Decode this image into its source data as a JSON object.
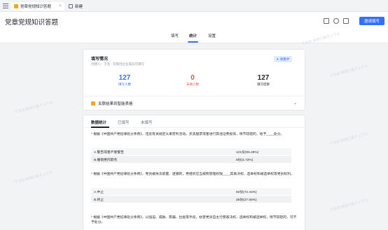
{
  "tabs": {
    "active_label": "党章党规知识答题",
    "close_glyph": "×",
    "new_label": "新建"
  },
  "header": {
    "title": "党章党规知识答题",
    "fill_button": "邀请填写",
    "nav": [
      "填写",
      "统计",
      "设置"
    ],
    "nav_active": "统计"
  },
  "summary": {
    "title": "填写情况",
    "meta": "创建人：于洛  ·  仅限创企业成员可填写",
    "status": "收集中",
    "stats": [
      {
        "value": "127",
        "label": "填写人数",
        "color": "#3370ff"
      },
      {
        "value": "0",
        "label": "未填人数",
        "color": "#f54a45"
      },
      {
        "value": "127",
        "label": "填写结果",
        "color": "#1f2329"
      }
    ],
    "link_label": "关联结果到智能表格"
  },
  "detail": {
    "tabs": [
      "数据统计",
      "已填写",
      "未填写"
    ],
    "questions": [
      {
        "text": "* 根据《中国共产党纪律处分条例》，违反有关规定从事营利活动，买卖股票或者进行其他证券投资，情节较轻的，给予____处分。",
        "options": [
          {
            "label": "A.警告或者严重警告",
            "count": "121份(95.28%)"
          },
          {
            "label": "B.撤销党内职务",
            "count": "6份(4.72%)"
          }
        ]
      },
      {
        "text": "* 根据《中国共产党纪律处分条例》，党员被依法留置、逮捕的，党组织应当按照管理权限____其表决权、选举权和被选举权等党员权利。",
        "options": [
          {
            "label": "A.中止",
            "count": "92份(72.44%)"
          },
          {
            "label": "B.终止",
            "count": "35份(27.56%)"
          }
        ]
      },
      {
        "text": "* 根据《中国共产党纪律处分条例》，以强迫、威胁、欺骗、拉拢等手段，妨害党员自主行使表决权、选举权和被选举权，情节较轻的，可不予处分。",
        "options": []
      }
    ]
  },
  "watermark": "于洛创 随我们基于上下文"
}
